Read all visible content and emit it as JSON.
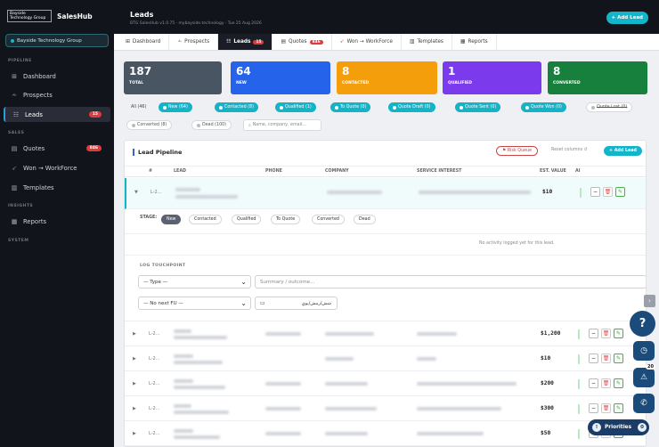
{
  "sidebar": {
    "logo_text": "Bayside Technology Group",
    "app_name": "SalesHub",
    "org_name": "Bayside Technology Group",
    "sections": {
      "pipeline": "PIPELINE",
      "sales": "SALES",
      "insights": "INSIGHTS",
      "system": "SYSTEM"
    },
    "items": [
      {
        "label": "Dashboard",
        "icon": "grid-icon"
      },
      {
        "label": "Prospects",
        "icon": "funnel-icon"
      },
      {
        "label": "Leads",
        "icon": "list-icon",
        "badge": "15"
      },
      {
        "label": "Quotes",
        "icon": "document-icon",
        "badge": "846"
      },
      {
        "label": "Won → WorkForce",
        "icon": "rocket-icon"
      },
      {
        "label": "Templates",
        "icon": "template-icon"
      },
      {
        "label": "Reports",
        "icon": "chart-icon"
      }
    ]
  },
  "topbar": {
    "title": "Leads",
    "subtitle": "BTG SalesHub v1.0.75 · mybayside.technology · Tue 25 Aug 2026",
    "add_lead": "+ Add Lead"
  },
  "tabs": [
    {
      "label": "Dashboard"
    },
    {
      "label": "Prospects"
    },
    {
      "label": "Leads",
      "badge": "15"
    },
    {
      "label": "Quotes",
      "badge": "846"
    },
    {
      "label": "Won → WorkForce"
    },
    {
      "label": "Templates"
    },
    {
      "label": "Reports"
    }
  ],
  "stats": [
    {
      "num": "187",
      "label": "TOTAL",
      "color": "#4a5563"
    },
    {
      "num": "64",
      "label": "NEW",
      "color": "#2563eb"
    },
    {
      "num": "8",
      "label": "CONTACTED",
      "color": "#f59e0b"
    },
    {
      "num": "1",
      "label": "QUALIFIED",
      "color": "#7c3aed"
    },
    {
      "num": "8",
      "label": "CONVERTED",
      "color": "#16803c"
    }
  ],
  "filters": {
    "all": "All (46)",
    "chips": [
      "New (64)",
      "Contacted (8)",
      "Qualified (1)",
      "To Quote (0)",
      "Quote Draft (0)",
      "Quote Sent (0)",
      "Quote Won (0)",
      "Quote Lost (0)",
      "Converted (8)",
      "Dead (100)"
    ],
    "search_placeholder": "Name, company, email..."
  },
  "panel": {
    "title": "Lead Pipeline",
    "risk_queue": "⚑ Risk Queue",
    "reset_columns": "Reset columns ↺",
    "add_lead": "+ Add Lead",
    "columns": [
      "#",
      "LEAD",
      "PHONE",
      "COMPANY",
      "SERVICE INTEREST",
      "EST. VALUE",
      "AI"
    ],
    "rows": [
      {
        "id": "L-2...",
        "value": "$10"
      },
      {
        "id": "L-2...",
        "value": "$1,200"
      },
      {
        "id": "L-2...",
        "value": "$10"
      },
      {
        "id": "L-2...",
        "value": "$200"
      },
      {
        "id": "L-2...",
        "value": "$300"
      },
      {
        "id": "L-2...",
        "value": "$50"
      }
    ],
    "expanded": {
      "stage_label": "STAGE:",
      "stages": [
        "New",
        "Contacted",
        "Qualified",
        "To Quote",
        "Converted",
        "Dead"
      ],
      "no_activity": "No activity logged yet for this lead.",
      "log_label": "LOG TOUCHPOINT",
      "type_select": "— Type —",
      "summary_placeholder": "Summary / outcome...",
      "fu_select": "— No next FU —",
      "date_placeholder": "شش/رمش/يوي"
    }
  },
  "floating": {
    "help": "?",
    "alert_count": "20",
    "priorities": "Priorities",
    "priorities_count": "0"
  }
}
